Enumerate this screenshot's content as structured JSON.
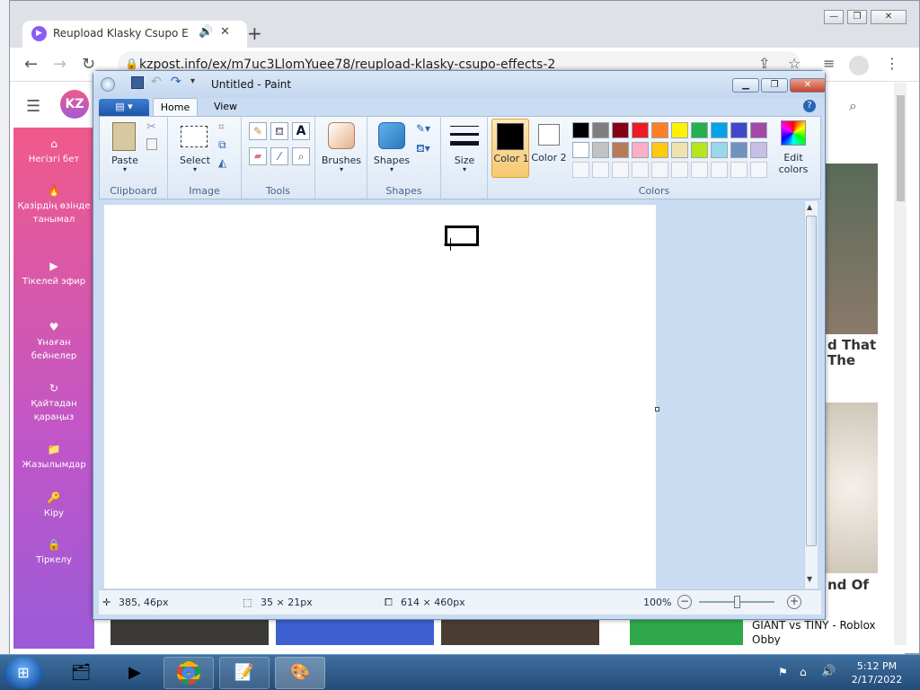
{
  "browser": {
    "tab_title": "Reupload Klasky Csupo Effec",
    "tab_audio": "🔊",
    "tab_close": "✕",
    "new_tab": "+",
    "url": "kzpost.info/ex/m7uc3LlomYuee78/reupload-klasky-csupo-effects-2",
    "win_min": "—",
    "win_max": "❐",
    "win_close": "✕"
  },
  "site": {
    "logo": "KZ",
    "sidebar": [
      {
        "icon": "⌂",
        "label": "Негізгі бет"
      },
      {
        "icon": "🔥",
        "label": "Қазірдің өзінде танымал"
      },
      {
        "icon": "▶",
        "label": "Тікелей эфир"
      },
      {
        "icon": "♥",
        "label": "Ұнаған бейнелер"
      },
      {
        "icon": "↻",
        "label": "Қайтадан қараңыз"
      },
      {
        "icon": "📁",
        "label": "Жазылымдар"
      },
      {
        "icon": "🔑",
        "label": "Кіру"
      },
      {
        "icon": "🔒",
        "label": "Тіркелу"
      }
    ],
    "card1_title": "d That The",
    "card2_title": "nd Of",
    "bottom_video_title": "GIANT vs TINY - Roblox Obby"
  },
  "paint": {
    "title": "Untitled - Paint",
    "tabs": {
      "file": "▤ ▾",
      "home": "Home",
      "view": "View"
    },
    "groups": {
      "clipboard": "Clipboard",
      "image": "Image",
      "tools": "Tools",
      "shapes": "Shapes",
      "colors": "Colors"
    },
    "buttons": {
      "paste": "Paste",
      "select": "Select",
      "brushes": "Brushes",
      "shapes": "Shapes",
      "size": "Size",
      "color1": "Color 1",
      "color2": "Color 2",
      "edit_colors": "Edit colors"
    },
    "colors": {
      "color1": "#000000",
      "color2": "#ffffff",
      "palette_row1": [
        "#000000",
        "#7f7f7f",
        "#880015",
        "#ed1c24",
        "#ff7f27",
        "#fff200",
        "#22b14c",
        "#00a2e8",
        "#3f48cc",
        "#a349a4"
      ],
      "palette_row2": [
        "#ffffff",
        "#c3c3c3",
        "#b97a57",
        "#ffaec9",
        "#ffc90e",
        "#efe4b0",
        "#b5e61d",
        "#99d9ea",
        "#7092be",
        "#c8bfe7"
      ]
    },
    "status": {
      "cursor": "385, 46px",
      "selection": "35 × 21px",
      "canvas_size": "614 × 460px",
      "zoom": "100%"
    }
  },
  "taskbar": {
    "time": "5:12 PM",
    "date": "2/17/2022"
  }
}
